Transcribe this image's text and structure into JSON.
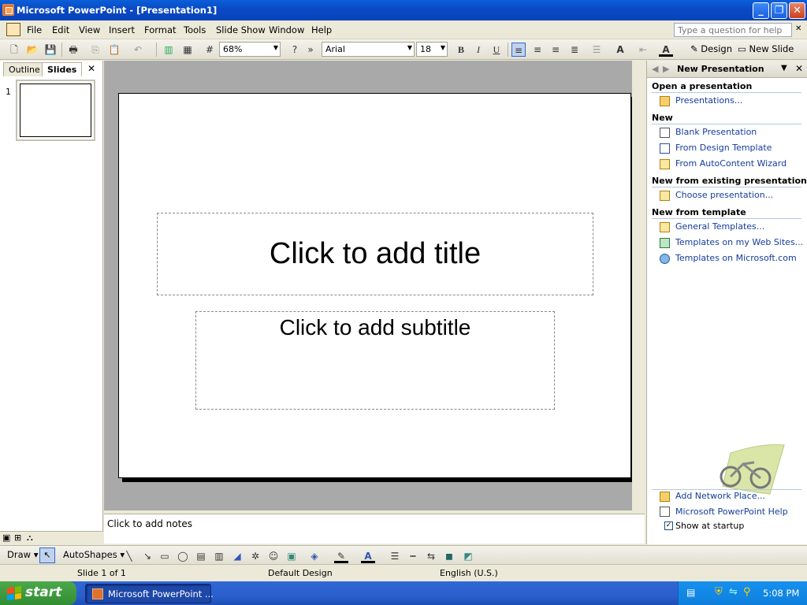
{
  "window": {
    "title": "Microsoft PowerPoint - [Presentation1]",
    "minimize": "_",
    "restore": "❐",
    "close": "✕"
  },
  "menus": [
    "File",
    "Edit",
    "View",
    "Insert",
    "Format",
    "Tools",
    "Slide Show",
    "Window",
    "Help"
  ],
  "help_box": {
    "placeholder": "Type a question for help"
  },
  "toolbar": {
    "zoom": "68%",
    "font": "Arial",
    "font_size": "18",
    "bold": "B",
    "italic": "I",
    "underline": "U",
    "design": "Design",
    "new_slide": "New Slide"
  },
  "left_panel": {
    "tabs": [
      "Outline",
      "Slides"
    ],
    "active_tab": "Slides",
    "slides": [
      {
        "number": "1"
      }
    ]
  },
  "slide": {
    "title_placeholder": "Click to add title",
    "subtitle_placeholder": "Click to add subtitle"
  },
  "notes": {
    "placeholder": "Click to add notes"
  },
  "task_pane": {
    "title": "New Presentation",
    "sections": [
      {
        "heading": "Open a presentation",
        "links": [
          "Presentations..."
        ]
      },
      {
        "heading": "New",
        "links": [
          "Blank Presentation",
          "From Design Template",
          "From AutoContent Wizard"
        ]
      },
      {
        "heading": "New from existing presentation",
        "links": [
          "Choose presentation..."
        ]
      },
      {
        "heading": "New from template",
        "links": [
          "General Templates...",
          "Templates on my Web Sites...",
          "Templates on Microsoft.com"
        ]
      }
    ],
    "footer_links": [
      "Add Network Place...",
      "Microsoft PowerPoint Help"
    ],
    "show_at_startup": "Show at startup"
  },
  "draw_toolbar": {
    "draw": "Draw",
    "autoshapes": "AutoShapes"
  },
  "status": {
    "slide": "Slide 1 of 1",
    "design": "Default Design",
    "language": "English (U.S.)"
  },
  "taskbar": {
    "start": "start",
    "app": "Microsoft PowerPoint ...",
    "time": "5:08 PM"
  }
}
